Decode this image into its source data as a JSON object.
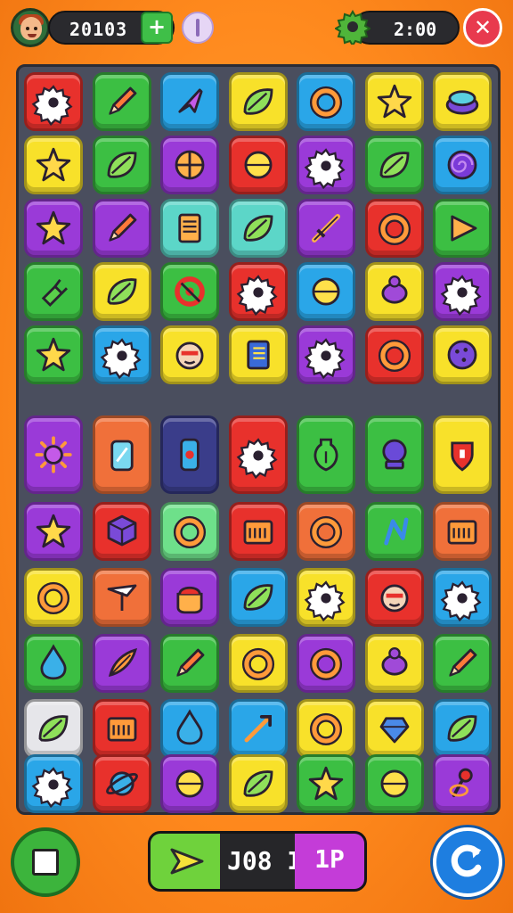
{
  "hud": {
    "score": "20103",
    "plus_label": "+",
    "timer": "2:00",
    "close_label": "✕"
  },
  "colors": {
    "red": "#e8312c",
    "green": "#3cbf43",
    "blue": "#2aa6e8",
    "yellow": "#f8e12a",
    "purple": "#9a3ad8",
    "orange": "#f0703a",
    "teal": "#5cd6c8",
    "mint": "#6ee08a",
    "white": "#e6e6ea",
    "navy": "#3a3d8a",
    "board": "#4a4e5e"
  },
  "board": {
    "rows": [
      [
        {
          "c": "red",
          "i": "gear"
        },
        {
          "c": "green",
          "i": "pencil"
        },
        {
          "c": "blue",
          "i": "rocket"
        },
        {
          "c": "yellow",
          "i": "leaf"
        },
        {
          "c": "blue",
          "i": "ring"
        },
        {
          "c": "yellow",
          "i": "star"
        },
        {
          "c": "yellow",
          "i": "blob"
        }
      ],
      [
        {
          "c": "yellow",
          "i": "star"
        },
        {
          "c": "green",
          "i": "leaf"
        },
        {
          "c": "purple",
          "i": "wheel"
        },
        {
          "c": "red",
          "i": "ball"
        },
        {
          "c": "purple",
          "i": "gear"
        },
        {
          "c": "green",
          "i": "leaf"
        },
        {
          "c": "blue",
          "i": "spiral"
        }
      ],
      [
        {
          "c": "purple",
          "i": "star"
        },
        {
          "c": "purple",
          "i": "pencil"
        },
        {
          "c": "teal",
          "i": "scroll"
        },
        {
          "c": "teal",
          "i": "leaf"
        },
        {
          "c": "purple",
          "i": "sword"
        },
        {
          "c": "red",
          "i": "ring"
        },
        {
          "c": "green",
          "i": "triangle"
        }
      ],
      [
        {
          "c": "green",
          "i": "plug"
        },
        {
          "c": "yellow",
          "i": "leaf"
        },
        {
          "c": "green",
          "i": "target"
        },
        {
          "c": "red",
          "i": "gear"
        },
        {
          "c": "blue",
          "i": "ball"
        },
        {
          "c": "yellow",
          "i": "bug"
        },
        {
          "c": "purple",
          "i": "gear"
        }
      ],
      [
        {
          "c": "green",
          "i": "star"
        },
        {
          "c": "blue",
          "i": "gear"
        },
        {
          "c": "yellow",
          "i": "face"
        },
        {
          "c": "yellow",
          "i": "book"
        },
        {
          "c": "purple",
          "i": "gear"
        },
        {
          "c": "red",
          "i": "ring"
        },
        {
          "c": "yellow",
          "i": "cookie"
        }
      ],
      [
        {
          "c": "purple",
          "i": "sun"
        },
        {
          "c": "orange",
          "i": "jar"
        },
        {
          "c": "navy",
          "i": "phone"
        },
        {
          "c": "red",
          "i": "gear"
        },
        {
          "c": "green",
          "i": "vase"
        },
        {
          "c": "green",
          "i": "orb"
        },
        {
          "c": "yellow",
          "i": "shield"
        }
      ],
      [
        {
          "c": "purple",
          "i": "star"
        },
        {
          "c": "red",
          "i": "cube"
        },
        {
          "c": "mint",
          "i": "ring"
        },
        {
          "c": "red",
          "i": "box"
        },
        {
          "c": "orange",
          "i": "ring"
        },
        {
          "c": "green",
          "i": "note"
        },
        {
          "c": "orange",
          "i": "box"
        }
      ],
      [
        {
          "c": "yellow",
          "i": "ring"
        },
        {
          "c": "orange",
          "i": "flag"
        },
        {
          "c": "purple",
          "i": "pot"
        },
        {
          "c": "blue",
          "i": "leaf"
        },
        {
          "c": "yellow",
          "i": "gear"
        },
        {
          "c": "red",
          "i": "face"
        },
        {
          "c": "blue",
          "i": "gear"
        }
      ],
      [
        {
          "c": "green",
          "i": "drop"
        },
        {
          "c": "purple",
          "i": "feather"
        },
        {
          "c": "green",
          "i": "pencil"
        },
        {
          "c": "yellow",
          "i": "ring"
        },
        {
          "c": "purple",
          "i": "ring"
        },
        {
          "c": "yellow",
          "i": "bug"
        },
        {
          "c": "green",
          "i": "pencil"
        }
      ],
      [
        {
          "c": "white",
          "i": "leaf"
        },
        {
          "c": "red",
          "i": "box"
        },
        {
          "c": "blue",
          "i": "drop"
        },
        {
          "c": "blue",
          "i": "arrow"
        },
        {
          "c": "yellow",
          "i": "ring"
        },
        {
          "c": "yellow",
          "i": "gem"
        },
        {
          "c": "blue",
          "i": "leaf"
        }
      ],
      [
        {
          "c": "blue",
          "i": "gear"
        },
        {
          "c": "red",
          "i": "planet"
        },
        {
          "c": "purple",
          "i": "ball"
        },
        {
          "c": "yellow",
          "i": "leaf"
        },
        {
          "c": "green",
          "i": "star"
        },
        {
          "c": "green",
          "i": "ball"
        },
        {
          "c": "purple",
          "i": "pin"
        }
      ]
    ]
  },
  "bottom": {
    "moves": "J08 I",
    "player": "1P"
  }
}
